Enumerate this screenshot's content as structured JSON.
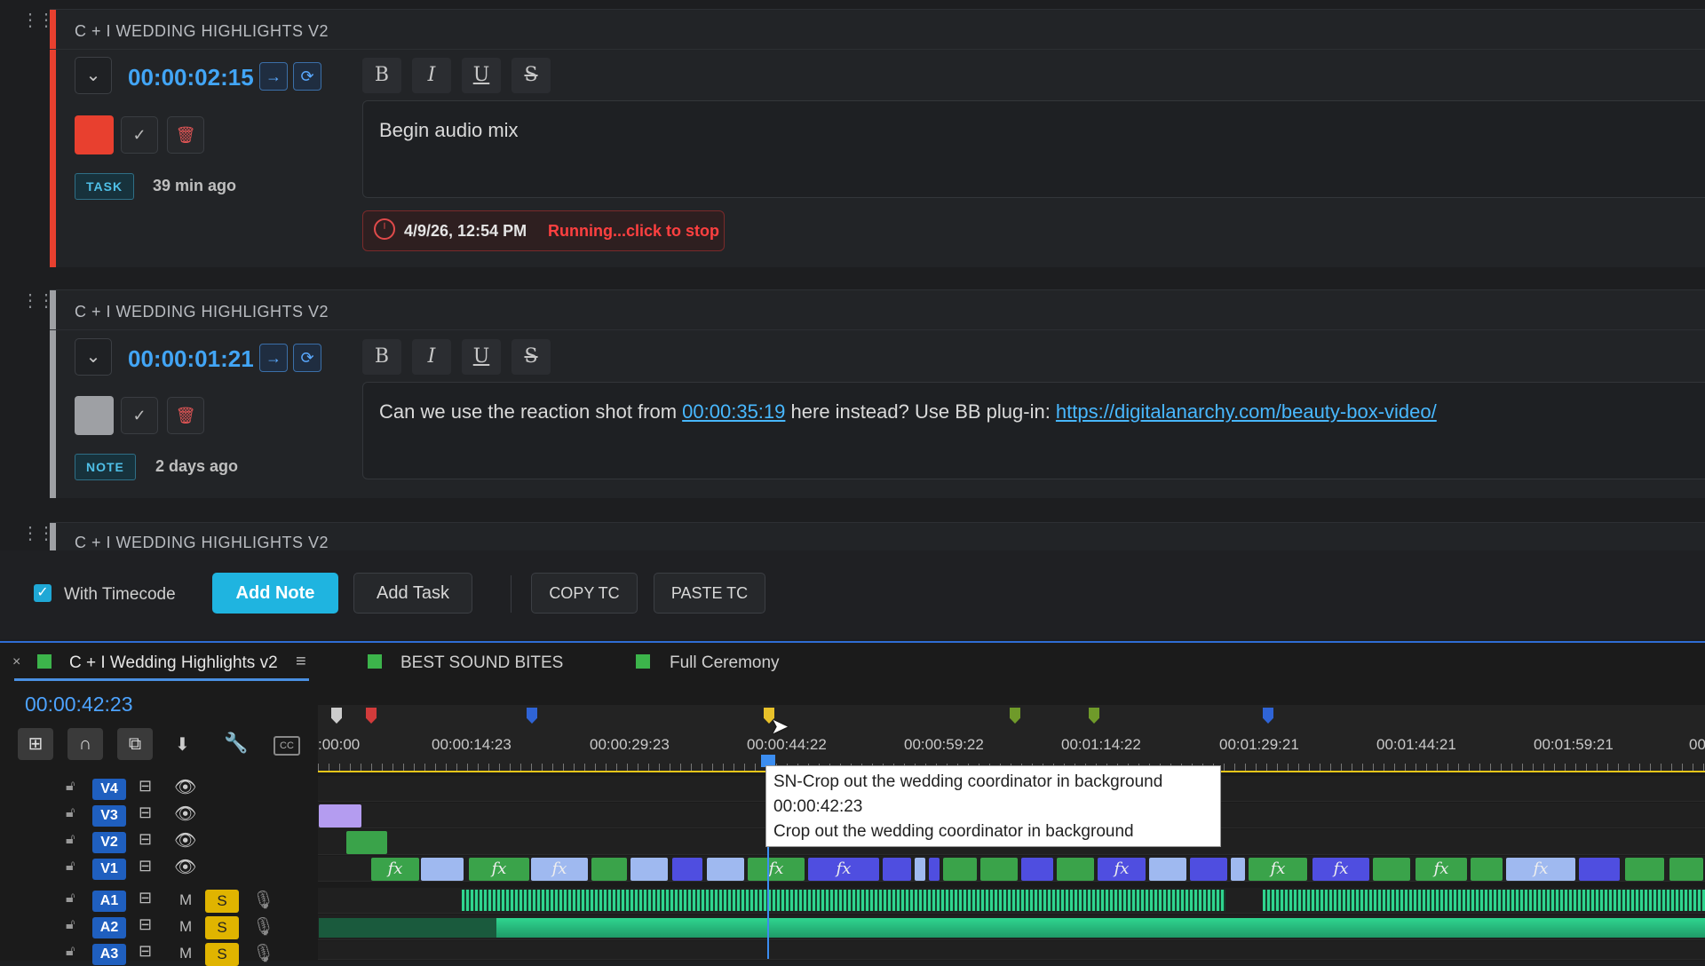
{
  "notes": [
    {
      "header": "C + I WEDDING HIGHLIGHTS V2",
      "timecode": "00:00:02:15",
      "color": "#e8402f",
      "text": "Begin audio mix",
      "badge": "TASK",
      "ago": "39 min ago",
      "timer": {
        "datetime": "4/9/26, 12:54 PM",
        "status": "Running...click to stop"
      }
    },
    {
      "header": "C + I WEDDING HIGHLIGHTS V2",
      "timecode": "00:00:01:21",
      "color": "#9ea0a4",
      "text_pre": "Can we use the reaction shot from ",
      "text_link_tc": "00:00:35:19",
      "text_mid": " here instead? Use BB plug-in: ",
      "text_link_url": "https://digitalanarchy.com/beauty-box-video/",
      "badge": "NOTE",
      "ago": "2 days ago"
    },
    {
      "header": "C + I WEDDING HIGHLIGHTS V2"
    }
  ],
  "format_buttons": [
    "B",
    "I",
    "U",
    "S"
  ],
  "toolbar": {
    "with_timecode_label": "With Timecode",
    "with_timecode_checked": true,
    "add_note": "Add Note",
    "add_task": "Add Task",
    "copy_tc": "COPY TC",
    "paste_tc": "PASTE TC"
  },
  "premiere": {
    "sequence_tab": "C + I Wedding Highlights v2",
    "tabs": [
      "BEST SOUND BITES",
      "Full Ceremony"
    ],
    "playhead_tc": "00:00:42:23",
    "ruler_labels": [
      ":00:00",
      "00:00:14:23",
      "00:00:29:23",
      "00:00:44:22",
      "00:00:59:22",
      "00:01:14:22",
      "00:01:29:21",
      "00:01:44:21",
      "00:01:59:21",
      "00"
    ],
    "video_tracks": [
      "V4",
      "V3",
      "V2",
      "V1"
    ],
    "audio_tracks": [
      "A1",
      "A2",
      "A3"
    ],
    "mute_label": "M",
    "solo_label": "S",
    "tooltip": {
      "line1": "SN-Crop out the wedding coordinator in background",
      "line2": "00:00:42:23",
      "line3": "Crop out the wedding coordinator in background"
    }
  }
}
